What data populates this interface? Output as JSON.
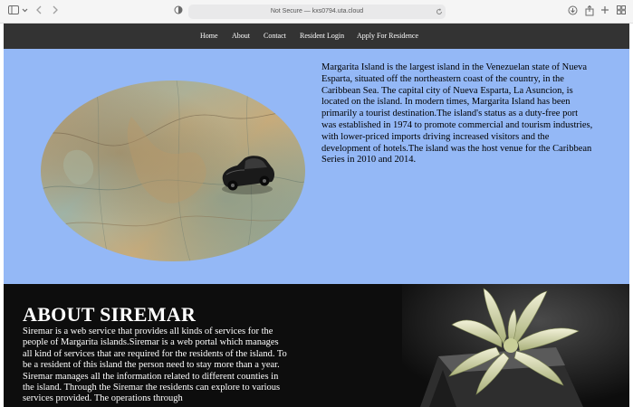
{
  "browser": {
    "url": "Not Secure — kxs0794.uta.cloud",
    "icons": [
      "sidebar-icon",
      "chevron-down-icon",
      "back-icon",
      "forward-icon",
      "shield-icon",
      "refresh-icon",
      "download-icon",
      "share-icon",
      "new-tab-icon",
      "tab-overview-icon"
    ]
  },
  "nav": {
    "items": [
      {
        "label": "Home"
      },
      {
        "label": "About"
      },
      {
        "label": "Contact"
      },
      {
        "label": "Resident Login"
      },
      {
        "label": "Apply For Residence"
      }
    ]
  },
  "hero": {
    "description": "Margarita Island is the largest island in the Venezuelan state of Nueva Esparta, situated off the northeastern coast of the country, in the Caribbean Sea. The capital city of Nueva Esparta, La Asuncion, is located on the island. In modern times, Margarita Island has been primarily a tourist destination.The island's status as a duty-free port was established in 1974 to promote commercial and tourism industries, with lower-priced imports driving increased visitors and the development of hotels.The island was the host venue for the Caribbean Series in 2010 and 2014."
  },
  "about": {
    "title": "ABOUT SIREMAR",
    "text": "Siremar is a web service that provides all kinds of services for the people of Margarita islands.Siremar is a web portal which manages all kind of services that are required for the residents of the island. To be a resident of this island the person need to stay more than a year. Siremar manages all the information related to different counties in the island. Through the Siremar the residents can explore to various services provided. The operations through"
  },
  "colors": {
    "nav_bg": "#333333",
    "hero_bg": "#94b8f6",
    "about_bg": "#0d0d0d"
  }
}
